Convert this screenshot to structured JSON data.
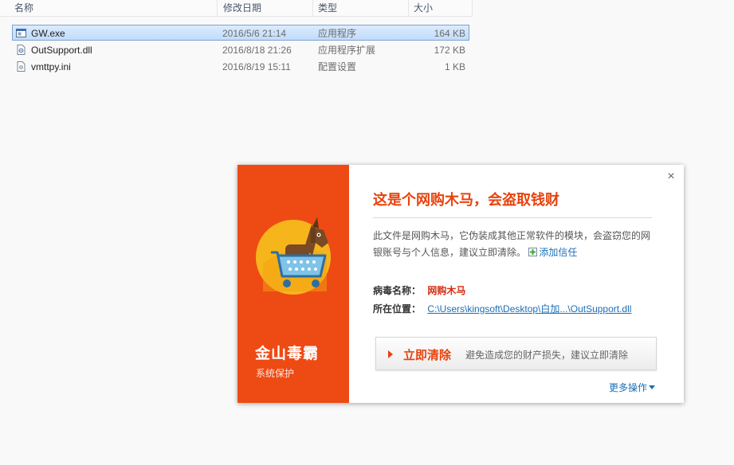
{
  "explorer": {
    "columns": {
      "name": "名称",
      "date": "修改日期",
      "type": "类型",
      "size": "大小"
    },
    "files": [
      {
        "name": "GW.exe",
        "date": "2016/5/6 21:14",
        "type": "应用程序",
        "size": "164 KB",
        "selected": true,
        "icon": "exe-icon"
      },
      {
        "name": "OutSupport.dll",
        "date": "2016/8/18 21:26",
        "type": "应用程序扩展",
        "size": "172 KB",
        "selected": false,
        "icon": "dll-icon"
      },
      {
        "name": "vmttpy.ini",
        "date": "2016/8/19 15:11",
        "type": "配置设置",
        "size": "1 KB",
        "selected": false,
        "icon": "ini-icon"
      }
    ]
  },
  "popup": {
    "brand": {
      "name": "金山毒霸",
      "subtitle": "系统保护",
      "color": "#ee4a14"
    },
    "close_label": "×",
    "title": "这是个网购木马，会盗取钱财",
    "description": "此文件是网购木马，它伪装成其他正常软件的模块，会盗窃您的网银账号与个人信息，建议立即清除。",
    "trust_link": "添加信任",
    "virus_label": "病毒名称：",
    "virus_name": "网购木马",
    "location_label": "所在位置：",
    "location_path": "C:\\Users\\kingsoft\\Desktop\\白加...\\OutSupport.dll",
    "action": {
      "label": "立即清除",
      "hint": "避免造成您的财产损失，建议立即清除"
    },
    "more_ops": "更多操作",
    "accent_color": "#e8420c",
    "link_color": "#1a6fb8"
  }
}
